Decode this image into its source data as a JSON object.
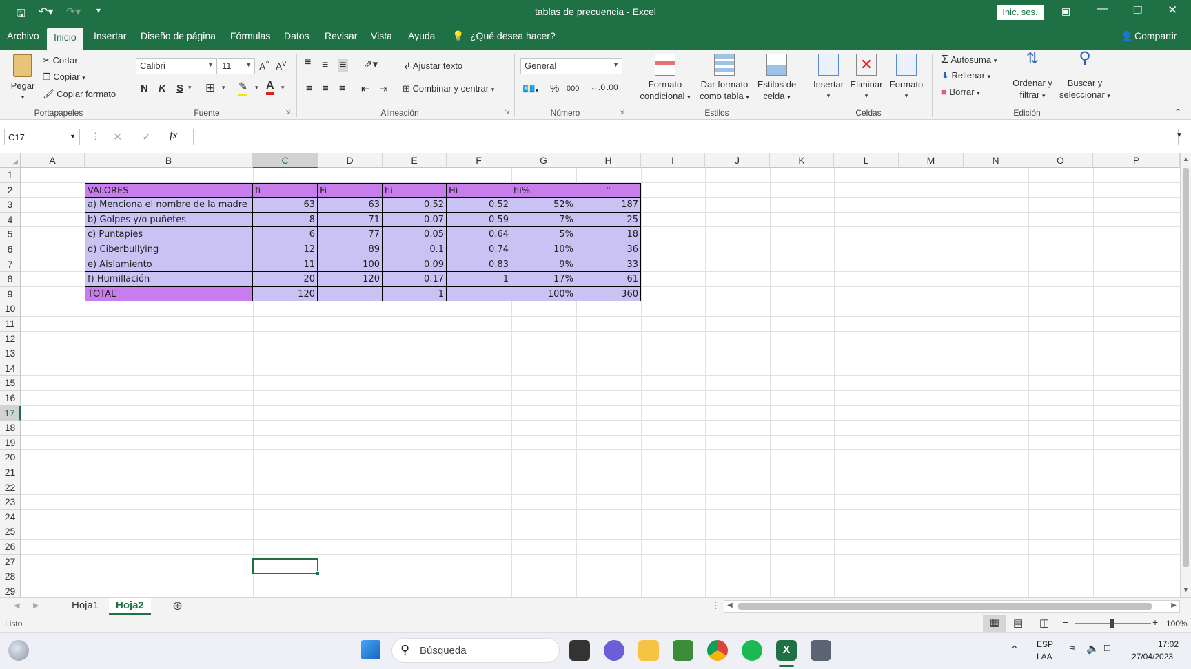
{
  "window": {
    "title": "tablas de precuencia  -  Excel",
    "signin_label": "Inic. ses."
  },
  "ribbon_tabs": [
    "Archivo",
    "Inicio",
    "Insertar",
    "Diseño de página",
    "Fórmulas",
    "Datos",
    "Revisar",
    "Vista",
    "Ayuda"
  ],
  "tell_me": "¿Qué desea hacer?",
  "share_label": "Compartir",
  "clipboard": {
    "paste": "Pegar",
    "cut": "Cortar",
    "copy": "Copiar",
    "format_painter": "Copiar formato",
    "group": "Portapapeles"
  },
  "font": {
    "name": "Calibri",
    "size": "11",
    "bold": "N",
    "italic": "K",
    "underline": "S",
    "group": "Fuente"
  },
  "alignment": {
    "wrap": "Ajustar texto",
    "merge": "Combinar y centrar",
    "group": "Alineación"
  },
  "number": {
    "format": "General",
    "group": "Número"
  },
  "styles": {
    "conditional": [
      "Formato",
      "condicional"
    ],
    "as_table": [
      "Dar formato",
      "como tabla"
    ],
    "cell_styles": [
      "Estilos de",
      "celda"
    ],
    "group": "Estilos"
  },
  "cells": {
    "insert": "Insertar",
    "delete": "Eliminar",
    "format": "Formato",
    "group": "Celdas"
  },
  "editing": {
    "autosum": "Autosuma",
    "fill": "Rellenar",
    "clear": "Borrar",
    "sort": [
      "Ordenar y",
      "filtrar"
    ],
    "find": [
      "Buscar y",
      "seleccionar"
    ],
    "group": "Edición"
  },
  "formula_bar": {
    "name_box": "C17",
    "fx": "fx",
    "content": ""
  },
  "columns": [
    "A",
    "B",
    "C",
    "D",
    "E",
    "F",
    "G",
    "H",
    "I",
    "J",
    "K",
    "L",
    "M",
    "N",
    "O",
    "P"
  ],
  "rows": [
    "1",
    "2",
    "3",
    "4",
    "5",
    "6",
    "7",
    "8",
    "9",
    "10",
    "11",
    "12",
    "13",
    "14",
    "15",
    "16",
    "17",
    "18",
    "19",
    "20",
    "21",
    "22",
    "23",
    "24",
    "25",
    "26",
    "27",
    "28",
    "29"
  ],
  "table": {
    "headers": [
      "VALORES",
      "fi",
      "Fi",
      "hi",
      "Hi",
      "hi%",
      "°"
    ],
    "rows": [
      [
        "a) Menciona el nombre de la madre",
        "63",
        "63",
        "0.52",
        "0.52",
        "52%",
        "187"
      ],
      [
        "b) Golpes y/o puñetes",
        "8",
        "71",
        "0.07",
        "0.59",
        "7%",
        "25"
      ],
      [
        "c) Puntapies",
        "6",
        "77",
        "0.05",
        "0.64",
        "5%",
        "18"
      ],
      [
        "d) Ciberbullying",
        "12",
        "89",
        "0.1",
        "0.74",
        "10%",
        "36"
      ],
      [
        "e) Aislamiento",
        "11",
        "100",
        "0.09",
        "0.83",
        "9%",
        "33"
      ],
      [
        "f) Humillación",
        "20",
        "120",
        "0.17",
        "1",
        "17%",
        "61"
      ]
    ],
    "total": [
      "TOTAL",
      "120",
      "",
      "1",
      "",
      "100%",
      "360"
    ]
  },
  "sheets": [
    "Hoja1",
    "Hoja2"
  ],
  "status": {
    "ready": "Listo",
    "zoom": "100%"
  },
  "taskbar": {
    "search": "Búsqueda",
    "lang1": "ESP",
    "lang2": "LAA",
    "time": "17:02",
    "date": "27/04/2023"
  },
  "colors": {
    "excel_green": "#1f7145",
    "header_fill": "#c77dec",
    "row_fill": "#c9c2f3"
  }
}
